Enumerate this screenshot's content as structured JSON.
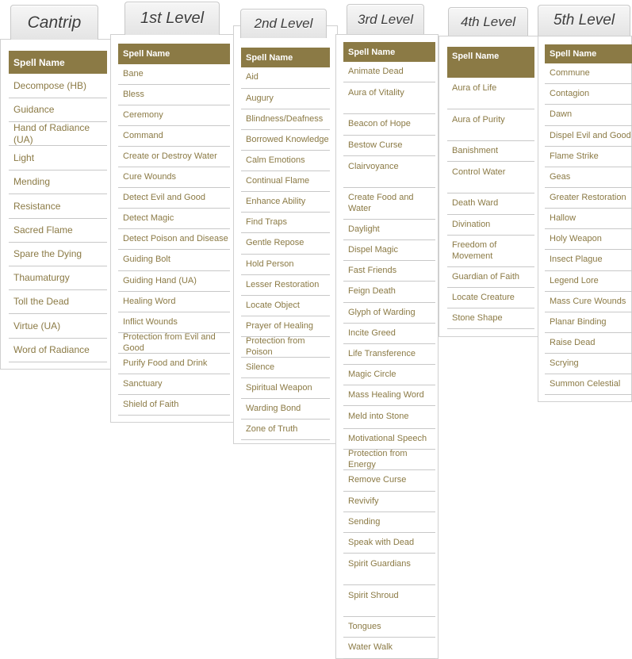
{
  "columns": [
    {
      "key": "cantrip",
      "tab": "Cantrip",
      "header": "Spell Name",
      "spells": [
        "Decompose (HB)",
        "Guidance",
        "Hand of Radiance (UA)",
        "Light",
        "Mending",
        "Resistance",
        "Sacred Flame",
        "Spare the Dying",
        "Thaumaturgy",
        "Toll the Dead",
        "Virtue (UA)",
        "Word of Radiance"
      ]
    },
    {
      "key": "level-1",
      "tab": "1st Level",
      "header": "Spell Name",
      "spells": [
        "Bane",
        "Bless",
        "Ceremony",
        "Command",
        "Create or Destroy Water",
        "Cure Wounds",
        "Detect Evil and Good",
        "Detect Magic",
        "Detect Poison and Disease",
        "Guiding Bolt",
        "Guiding Hand (UA)",
        "Healing Word",
        "Inflict Wounds",
        "Protection from Evil and Good",
        "Purify Food and Drink",
        "Sanctuary",
        "Shield of Faith"
      ]
    },
    {
      "key": "level-2",
      "tab": "2nd Level",
      "header": "Spell Name",
      "spells": [
        "Aid",
        "Augury",
        "Blindness/Deafness",
        "Borrowed Knowledge",
        "Calm Emotions",
        "Continual Flame",
        "Enhance Ability",
        "Find Traps",
        "Gentle Repose",
        "Hold Person",
        "Lesser Restoration",
        "Locate Object",
        "Prayer of Healing",
        "Protection from Poison",
        "Silence",
        "Spiritual Weapon",
        "Warding Bond",
        "Zone of Truth"
      ]
    },
    {
      "key": "level-3",
      "tab": "3rd Level",
      "header": "Spell Name",
      "spells": [
        "Animate Dead",
        "Aura of Vitality",
        "Beacon of Hope",
        "Bestow Curse",
        "Clairvoyance",
        "Create Food and Water",
        "Daylight",
        "Dispel Magic",
        "Fast Friends",
        "Feign Death",
        "Glyph of Warding",
        "Incite Greed",
        "Life Transference",
        "Magic Circle",
        "Mass Healing Word",
        "Meld into Stone",
        "Motivational Speech",
        "Protection from Energy",
        "Remove Curse",
        "Revivify",
        "Sending",
        "Speak with Dead",
        "Spirit Guardians",
        "Spirit Shroud",
        "Tongues",
        "Water Walk"
      ]
    },
    {
      "key": "level-4",
      "tab": "4th Level",
      "header": "Spell Name",
      "spells": [
        "Aura of Life",
        "Aura of Purity",
        "Banishment",
        "Control Water",
        "Death Ward",
        "Divination",
        "Freedom of Movement",
        "Guardian of Faith",
        "Locate Creature",
        "Stone Shape"
      ]
    },
    {
      "key": "level-5",
      "tab": "5th Level",
      "header": "Spell Name",
      "spells": [
        "Commune",
        "Contagion",
        "Dawn",
        "Dispel Evil and Good",
        "Flame Strike",
        "Geas",
        "Greater Restoration",
        "Hallow",
        "Holy Weapon",
        "Insect Plague",
        "Legend Lore",
        "Mass Cure Wounds",
        "Planar Binding",
        "Raise Dead",
        "Scrying",
        "Summon Celestial"
      ]
    }
  ]
}
